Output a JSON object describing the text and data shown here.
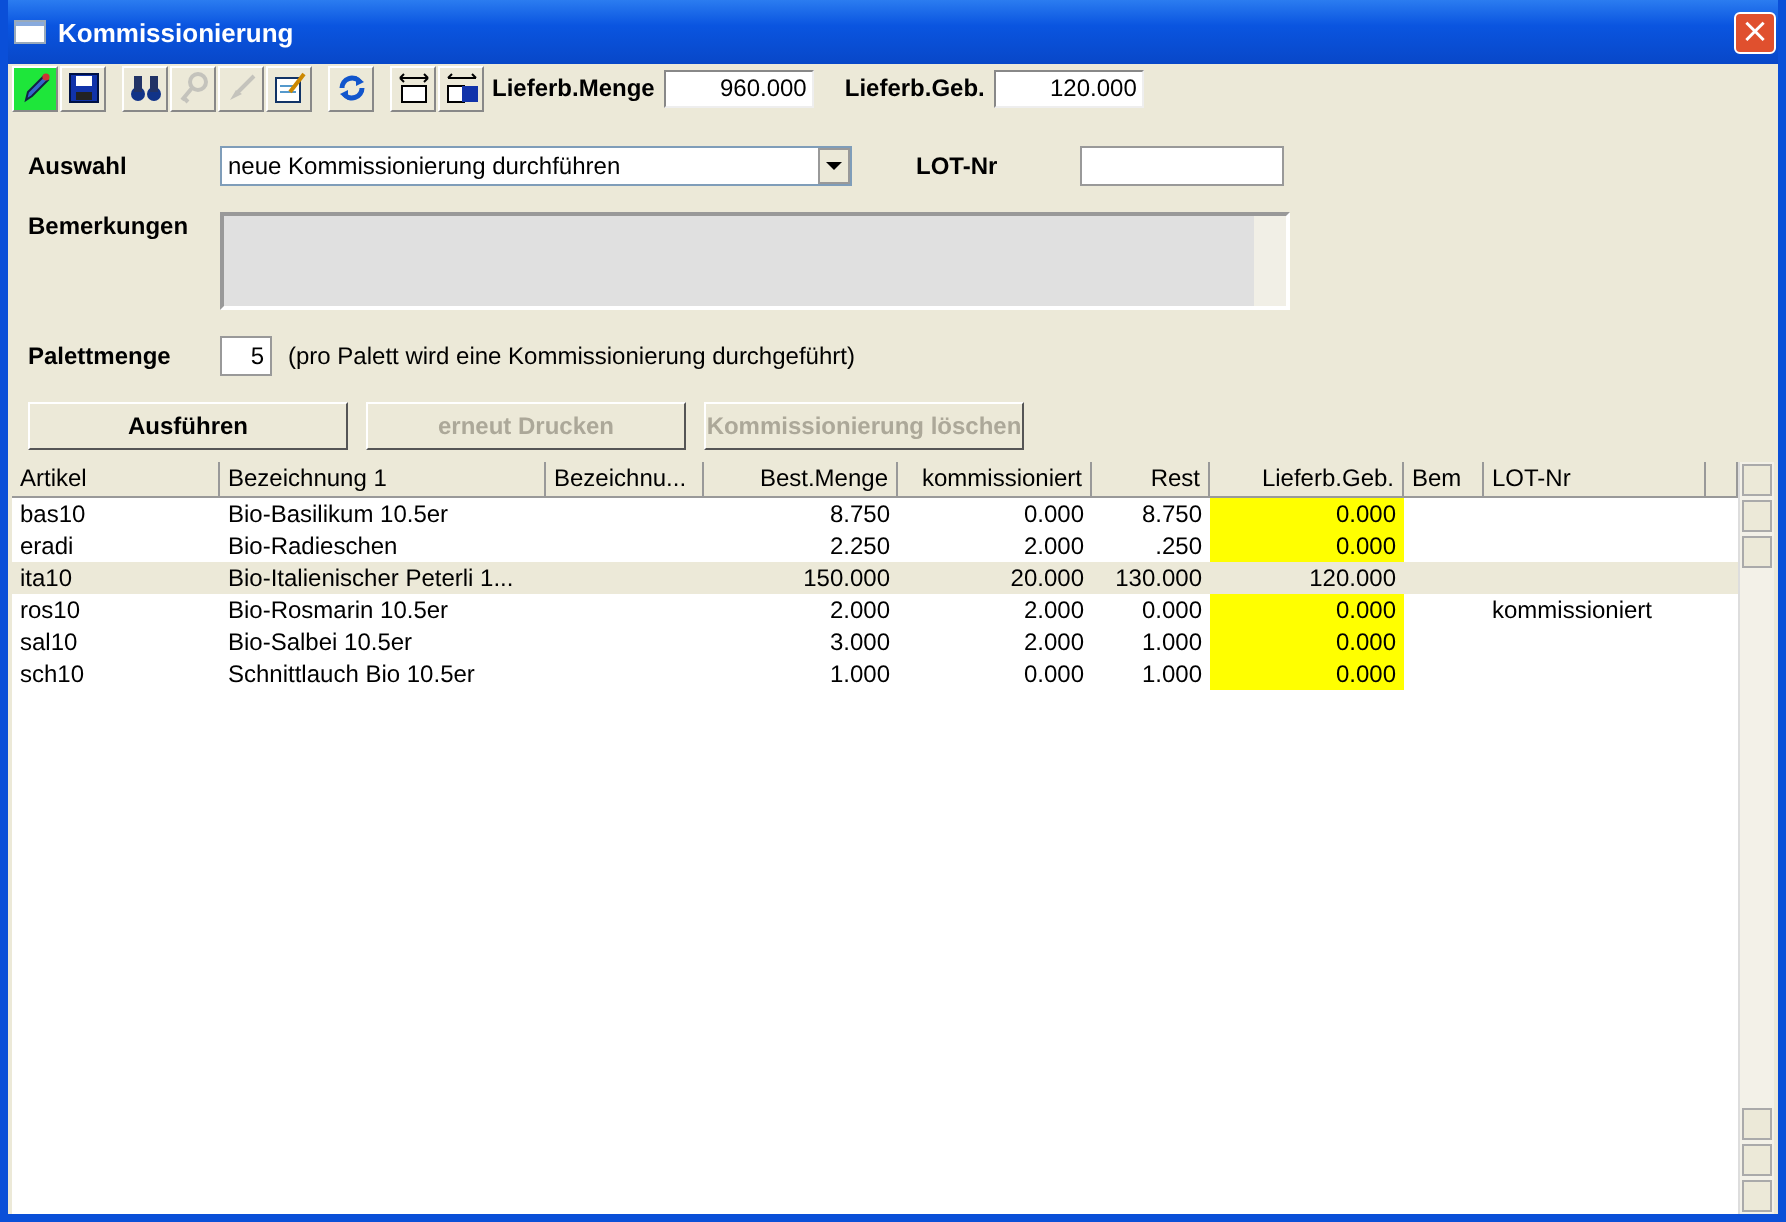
{
  "window": {
    "title": "Kommissionierung",
    "close": "×"
  },
  "toolbar": {
    "buttons": [
      {
        "kind": "pencil",
        "selected": true,
        "disabled": false
      },
      {
        "kind": "save",
        "selected": false,
        "disabled": false
      },
      {
        "kind": "binoculars",
        "selected": false,
        "disabled": false
      },
      {
        "kind": "key",
        "selected": false,
        "disabled": true
      },
      {
        "kind": "brush",
        "selected": false,
        "disabled": true
      },
      {
        "kind": "edit",
        "selected": false,
        "disabled": false
      },
      {
        "kind": "refresh",
        "selected": false,
        "disabled": false
      },
      {
        "kind": "expand",
        "selected": false,
        "disabled": false
      },
      {
        "kind": "expand-save",
        "selected": false,
        "disabled": false
      }
    ],
    "fields": [
      {
        "label": "Lieferb.Menge",
        "value": "960.000"
      },
      {
        "label": "Lieferb.Geb.",
        "value": "120.000"
      }
    ]
  },
  "form": {
    "auswahl_label": "Auswahl",
    "auswahl_value": "neue Kommissionierung durchführen",
    "lot_label": "LOT-Nr",
    "remarks_label": "Bemerkungen",
    "pallet_label": "Palettmenge",
    "pallet_value": "5",
    "pallet_note": "(pro Palett wird eine Kommissionierung durchgeführt)"
  },
  "actions": [
    {
      "label": "Ausführen",
      "disabled": false
    },
    {
      "label": "erneut Drucken",
      "disabled": true
    },
    {
      "label": "Kommissionierung löschen",
      "disabled": true
    }
  ],
  "table": {
    "columns": [
      "Artikel",
      "Bezeichnung 1",
      "Bezeichnu...",
      "Best.Menge",
      "kommissioniert",
      "Rest",
      "Lieferb.Geb.",
      "Bem",
      "LOT-Nr"
    ],
    "rows": [
      {
        "cells": [
          "bas10",
          "Bio-Basilikum 10.5er",
          "",
          "8.750",
          "0.000",
          "8.750",
          "0.000",
          "",
          ""
        ],
        "selected": false,
        "highlight": true
      },
      {
        "cells": [
          "eradi",
          "Bio-Radieschen",
          "",
          "2.250",
          "2.000",
          ".250",
          "0.000",
          "",
          ""
        ],
        "selected": false,
        "highlight": true
      },
      {
        "cells": [
          "ita10",
          "Bio-Italienischer Peterli 1...",
          "",
          "150.000",
          "20.000",
          "130.000",
          "120.000",
          "",
          ""
        ],
        "selected": true,
        "highlight": false
      },
      {
        "cells": [
          "ros10",
          "Bio-Rosmarin 10.5er",
          "",
          "2.000",
          "2.000",
          "0.000",
          "0.000",
          "",
          "kommissioniert"
        ],
        "selected": false,
        "highlight": true
      },
      {
        "cells": [
          "sal10",
          "Bio-Salbei 10.5er",
          "",
          "3.000",
          "2.000",
          "1.000",
          "0.000",
          "",
          ""
        ],
        "selected": false,
        "highlight": true
      },
      {
        "cells": [
          "sch10",
          "Schnittlauch Bio 10.5er",
          "",
          "1.000",
          "0.000",
          "1.000",
          "0.000",
          "",
          ""
        ],
        "selected": false,
        "highlight": true
      }
    ]
  }
}
